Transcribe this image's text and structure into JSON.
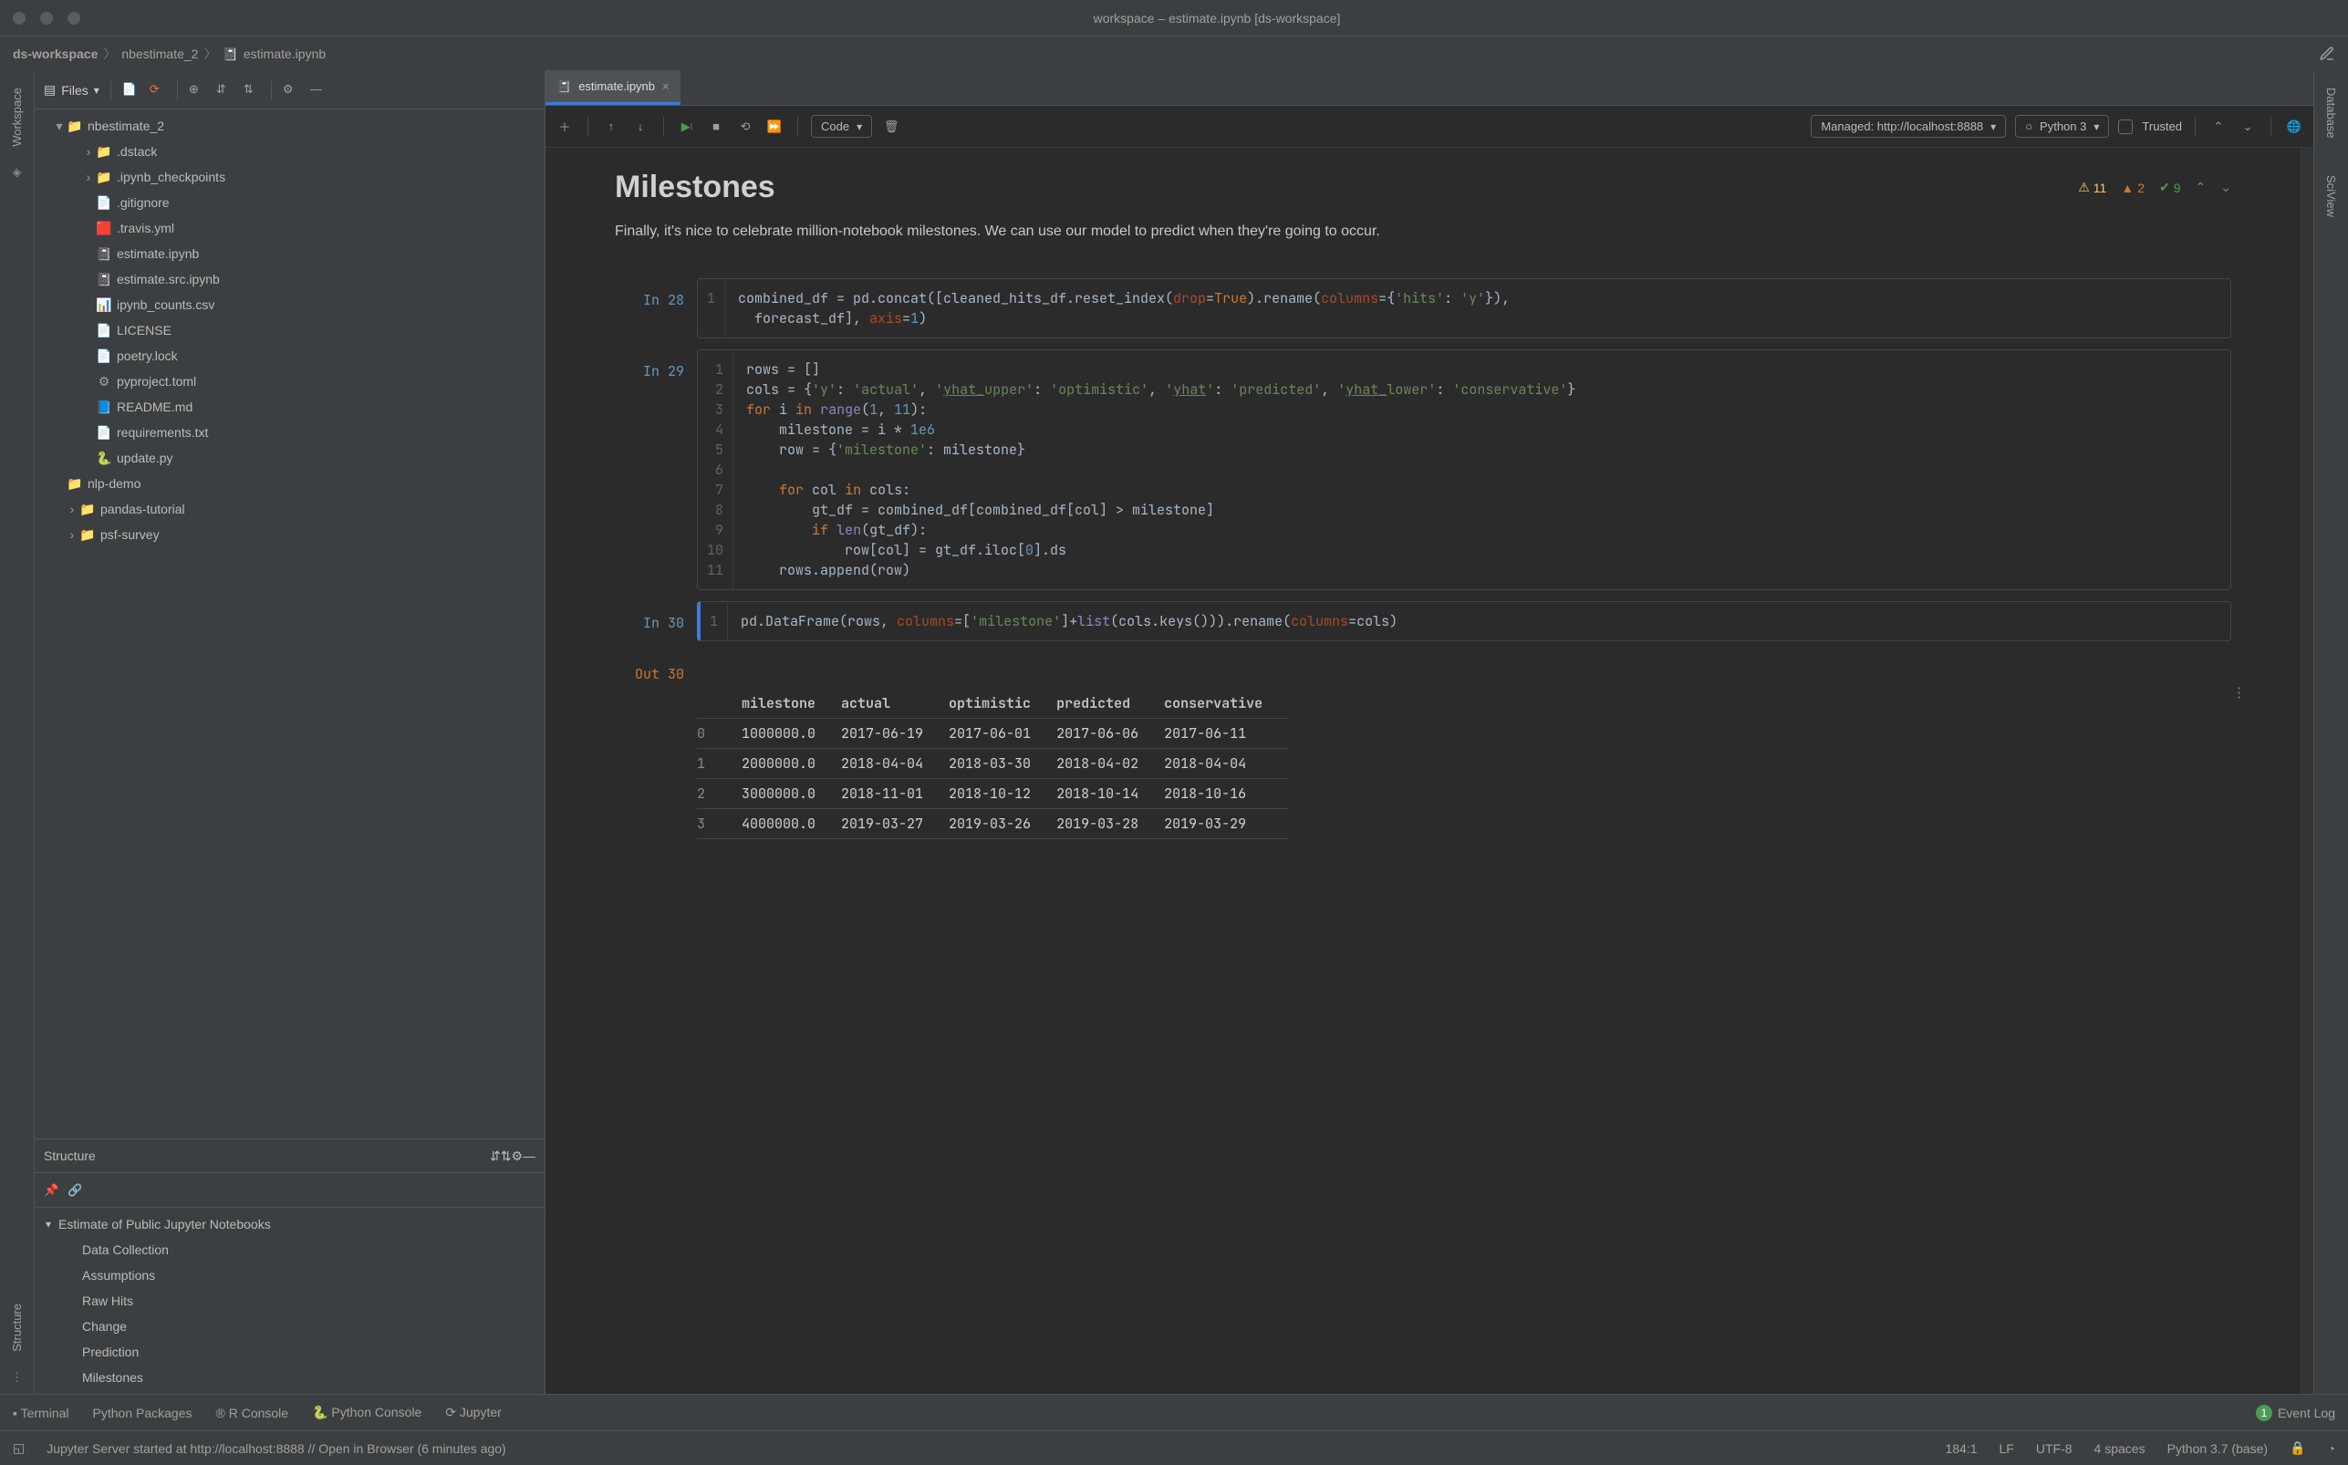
{
  "window": {
    "title": "workspace – estimate.ipynb [ds-workspace]"
  },
  "breadcrumbs": [
    "ds-workspace",
    "nbestimate_2",
    "estimate.ipynb"
  ],
  "files_panel": {
    "label": "Files",
    "tree": [
      {
        "depth": 0,
        "name": "nbestimate_2",
        "kind": "folder",
        "expanded": true
      },
      {
        "depth": 1,
        "name": ".dstack",
        "kind": "folder",
        "expanded": false,
        "chev": true
      },
      {
        "depth": 1,
        "name": ".ipynb_checkpoints",
        "kind": "folder",
        "expanded": false,
        "chev": true
      },
      {
        "depth": 1,
        "name": ".gitignore",
        "kind": "file"
      },
      {
        "depth": 1,
        "name": ".travis.yml",
        "kind": "yml"
      },
      {
        "depth": 1,
        "name": "estimate.ipynb",
        "kind": "ipynb"
      },
      {
        "depth": 1,
        "name": "estimate.src.ipynb",
        "kind": "ipynb"
      },
      {
        "depth": 1,
        "name": "ipynb_counts.csv",
        "kind": "csv"
      },
      {
        "depth": 1,
        "name": "LICENSE",
        "kind": "file"
      },
      {
        "depth": 1,
        "name": "poetry.lock",
        "kind": "file"
      },
      {
        "depth": 1,
        "name": "pyproject.toml",
        "kind": "toml"
      },
      {
        "depth": 1,
        "name": "README.md",
        "kind": "md"
      },
      {
        "depth": 1,
        "name": "requirements.txt",
        "kind": "file"
      },
      {
        "depth": 1,
        "name": "update.py",
        "kind": "py"
      },
      {
        "depth": 0,
        "name": "nlp-demo",
        "kind": "folder"
      },
      {
        "depth": 0,
        "name": "pandas-tutorial",
        "kind": "folder",
        "chev": true,
        "chevside": true
      },
      {
        "depth": 0,
        "name": "psf-survey",
        "kind": "folder",
        "chev": true,
        "chevside": true
      }
    ]
  },
  "structure_panel": {
    "label": "Structure",
    "root": "Estimate of Public Jupyter Notebooks",
    "items": [
      "Data Collection",
      "Assumptions",
      "Raw Hits",
      "Change",
      "Prediction",
      "Milestones"
    ]
  },
  "left_rail": {
    "workspace": "Workspace",
    "structure": "Structure"
  },
  "right_rail": {
    "database": "Database",
    "sciview": "SciView"
  },
  "editor": {
    "tab": "estimate.ipynb",
    "toolbar": {
      "code_label": "Code",
      "managed_label": "Managed: http://localhost:8888",
      "kernel_label": "Python 3",
      "trusted_label": "Trusted"
    },
    "inspections": {
      "warn": "11",
      "weak": "2",
      "ok": "9"
    },
    "markdown": {
      "title": "Milestones",
      "body": "Finally, it's nice to celebrate million-notebook milestones. We can use our model to predict when they're going to occur."
    },
    "cells": {
      "in28": "In 28",
      "in29": "In 29",
      "in30": "In 30",
      "out30": "Out 30"
    },
    "table": {
      "headers": [
        "",
        "milestone",
        "actual",
        "optimistic",
        "predicted",
        "conservative"
      ],
      "rows": [
        [
          "0",
          "1000000.0",
          "2017-06-19",
          "2017-06-01",
          "2017-06-06",
          "2017-06-11"
        ],
        [
          "1",
          "2000000.0",
          "2018-04-04",
          "2018-03-30",
          "2018-04-02",
          "2018-04-04"
        ],
        [
          "2",
          "3000000.0",
          "2018-11-01",
          "2018-10-12",
          "2018-10-14",
          "2018-10-16"
        ],
        [
          "3",
          "4000000.0",
          "2019-03-27",
          "2019-03-26",
          "2019-03-28",
          "2019-03-29"
        ]
      ]
    }
  },
  "bottom_tools": {
    "terminal": "Terminal",
    "python_packages": "Python Packages",
    "r_console": "R Console",
    "python_console": "Python Console",
    "jupyter": "Jupyter",
    "event_log_count": "1",
    "event_log": "Event Log"
  },
  "status": {
    "message": "Jupyter Server started at http://localhost:8888 // Open in Browser (6 minutes ago)",
    "pos": "184:1",
    "sep": "LF",
    "encoding": "UTF-8",
    "indent": "4 spaces",
    "interpreter": "Python 3.7 (base)"
  }
}
